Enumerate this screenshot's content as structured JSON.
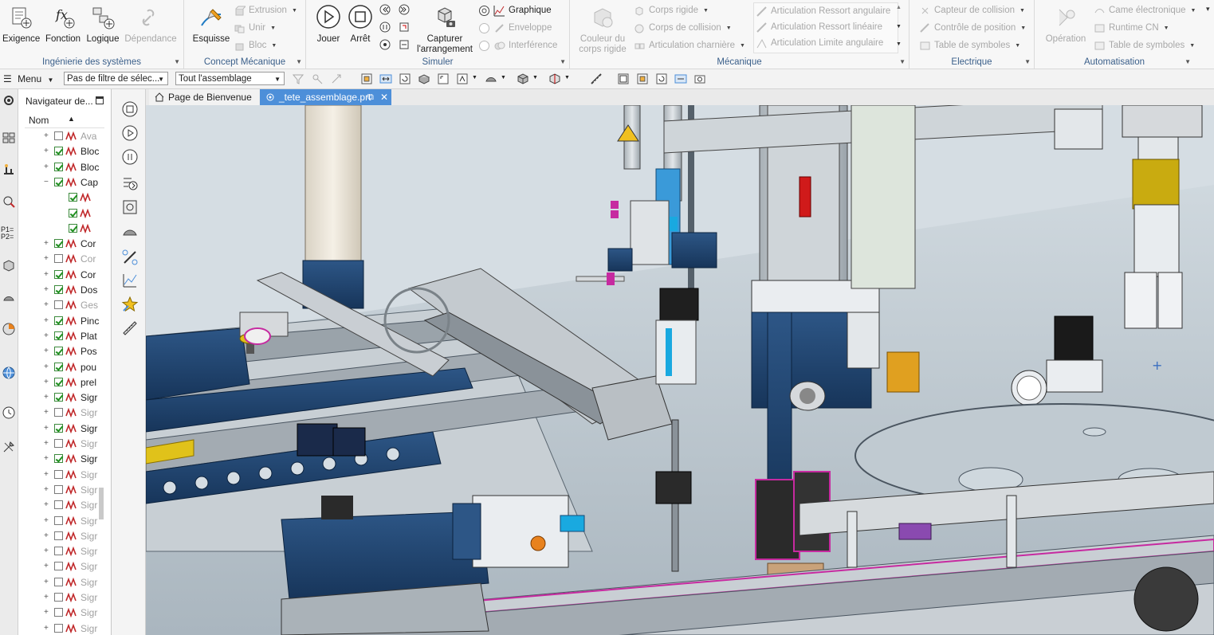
{
  "ribbon": {
    "groups": [
      {
        "label": "Ingénierie des systèmes",
        "buttons": [
          {
            "label": "Exigence",
            "icon": "requirement-icon",
            "disabled": false
          },
          {
            "label": "Fonction",
            "icon": "function-icon",
            "disabled": false
          },
          {
            "label": "Logique",
            "icon": "logic-icon",
            "disabled": false
          },
          {
            "label": "Dépendance",
            "icon": "dependency-icon",
            "disabled": true
          }
        ]
      },
      {
        "label": "Concept Mécanique",
        "big": {
          "label": "Esquisse",
          "icon": "sketch-icon"
        },
        "small": [
          {
            "label": "Extrusion",
            "icon": "extrude-icon",
            "disabled": true
          },
          {
            "label": "Unir",
            "icon": "unite-icon",
            "disabled": true
          },
          {
            "label": "Bloc",
            "icon": "block-icon",
            "disabled": true
          }
        ]
      },
      {
        "label": "Simuler",
        "buttons": [
          {
            "label": "Jouer",
            "icon": "play-icon"
          },
          {
            "label": "Arrêt",
            "icon": "stop-icon"
          }
        ],
        "capture": {
          "line1": "Capturer",
          "line2": "l'arrangement",
          "icon": "capture-arrangement-icon"
        },
        "small": [
          {
            "label": "Graphique",
            "icon": "graph-icon",
            "disabled": false
          },
          {
            "label": "Enveloppe",
            "icon": "envelope-icon",
            "disabled": true
          },
          {
            "label": "Interférence",
            "icon": "interference-icon",
            "disabled": true
          }
        ]
      },
      {
        "label": "Mécanique",
        "big": {
          "line1": "Couleur du",
          "line2": "corps rigide",
          "icon": "rigid-body-color-icon",
          "disabled": true
        },
        "small_col1": [
          {
            "label": "Corps rigide",
            "icon": "rigid-body-icon"
          },
          {
            "label": "Corps de collision",
            "icon": "collision-body-icon"
          },
          {
            "label": "Articulation charnière",
            "icon": "hinge-joint-icon"
          }
        ],
        "small_col2": [
          {
            "label": "Articulation Ressort angulaire",
            "icon": "angular-spring-icon"
          },
          {
            "label": "Articulation Ressort linéaire",
            "icon": "linear-spring-icon"
          },
          {
            "label": "Articulation Limite angulaire",
            "icon": "angular-limit-icon"
          }
        ]
      },
      {
        "label": "Electrique",
        "small": [
          {
            "label": "Capteur de collision",
            "icon": "collision-sensor-icon"
          },
          {
            "label": "Contrôle de position",
            "icon": "position-control-icon"
          },
          {
            "label": "Table de symboles",
            "icon": "symbol-table-icon"
          }
        ]
      },
      {
        "label": "Automatisation",
        "big": {
          "label": "Opération",
          "icon": "operation-icon",
          "disabled": true
        },
        "small": [
          {
            "label": "Came électronique",
            "icon": "electronic-cam-icon"
          },
          {
            "label": "Runtime CN",
            "icon": "runtime-cn-icon"
          },
          {
            "label": "Table de symboles",
            "icon": "symbol-table-icon"
          }
        ]
      }
    ]
  },
  "command_bar": {
    "menu_label": "Menu",
    "filter_value": "Pas de filtre de sélec...",
    "scope_value": "Tout l'assemblage"
  },
  "navigator": {
    "title": "Navigateur de...",
    "column": "Nom",
    "rows": [
      {
        "label": "Ava",
        "checked": false,
        "dim": true,
        "level": 1,
        "expander": "+"
      },
      {
        "label": "Bloc",
        "checked": true,
        "dim": false,
        "level": 1,
        "expander": "+"
      },
      {
        "label": "Bloc",
        "checked": true,
        "dim": false,
        "level": 1,
        "expander": "+"
      },
      {
        "label": "Cap",
        "checked": true,
        "dim": false,
        "level": 1,
        "expander": "-"
      },
      {
        "label": "",
        "checked": true,
        "dim": false,
        "level": 2,
        "expander": ""
      },
      {
        "label": "",
        "checked": true,
        "dim": false,
        "level": 2,
        "expander": ""
      },
      {
        "label": "",
        "checked": true,
        "dim": false,
        "level": 2,
        "expander": ""
      },
      {
        "label": "Cor",
        "checked": true,
        "dim": false,
        "level": 1,
        "expander": "+"
      },
      {
        "label": "Cor",
        "checked": false,
        "dim": true,
        "level": 1,
        "expander": "+"
      },
      {
        "label": "Cor",
        "checked": true,
        "dim": false,
        "level": 1,
        "expander": "+"
      },
      {
        "label": "Dos",
        "checked": true,
        "dim": false,
        "level": 1,
        "expander": "+"
      },
      {
        "label": "Ges",
        "checked": false,
        "dim": true,
        "level": 1,
        "expander": "+"
      },
      {
        "label": "Pinc",
        "checked": true,
        "dim": false,
        "level": 1,
        "expander": "+"
      },
      {
        "label": "Plat",
        "checked": true,
        "dim": false,
        "level": 1,
        "expander": "+"
      },
      {
        "label": "Pos",
        "checked": true,
        "dim": false,
        "level": 1,
        "expander": "+"
      },
      {
        "label": "pou",
        "checked": true,
        "dim": false,
        "level": 1,
        "expander": "+"
      },
      {
        "label": "prel",
        "checked": true,
        "dim": false,
        "level": 1,
        "expander": "+"
      },
      {
        "label": "Sigr",
        "checked": true,
        "dim": false,
        "level": 1,
        "expander": "+"
      },
      {
        "label": "Sigr",
        "checked": false,
        "dim": true,
        "level": 1,
        "expander": "+"
      },
      {
        "label": "Sigr",
        "checked": true,
        "dim": false,
        "level": 1,
        "expander": "+"
      },
      {
        "label": "Sigr",
        "checked": false,
        "dim": true,
        "level": 1,
        "expander": "+"
      },
      {
        "label": "Sigr",
        "checked": true,
        "dim": false,
        "level": 1,
        "expander": "+"
      },
      {
        "label": "Sigr",
        "checked": false,
        "dim": true,
        "level": 1,
        "expander": "+"
      },
      {
        "label": "Sigr",
        "checked": false,
        "dim": true,
        "level": 1,
        "expander": "+"
      },
      {
        "label": "Sigr",
        "checked": false,
        "dim": true,
        "level": 1,
        "expander": "+"
      },
      {
        "label": "Sigr",
        "checked": false,
        "dim": true,
        "level": 1,
        "expander": "+"
      },
      {
        "label": "Sigr",
        "checked": false,
        "dim": true,
        "level": 1,
        "expander": "+"
      },
      {
        "label": "Sigr",
        "checked": false,
        "dim": true,
        "level": 1,
        "expander": "+"
      },
      {
        "label": "Sigr",
        "checked": false,
        "dim": true,
        "level": 1,
        "expander": "+"
      },
      {
        "label": "Sigr",
        "checked": false,
        "dim": true,
        "level": 1,
        "expander": "+"
      },
      {
        "label": "Sigr",
        "checked": false,
        "dim": true,
        "level": 1,
        "expander": "+"
      },
      {
        "label": "Sigr",
        "checked": false,
        "dim": true,
        "level": 1,
        "expander": "+"
      },
      {
        "label": "Sigr",
        "checked": false,
        "dim": true,
        "level": 1,
        "expander": "+"
      }
    ]
  },
  "tabs": [
    {
      "label": "Page de Bienvenue",
      "active": false
    },
    {
      "label": "_tete_assemblage.prt",
      "active": true
    }
  ],
  "colors": {
    "accent": "#4d8fd9",
    "ribbon_group_label": "#3a5f8a",
    "check_green": "#1f8f1f",
    "signal_red": "#c0282a",
    "model_navy": "#1e3f66",
    "model_cyan": "#19a9e0",
    "model_magenta": "#c62aa0",
    "model_yellow": "#e0c21a"
  }
}
